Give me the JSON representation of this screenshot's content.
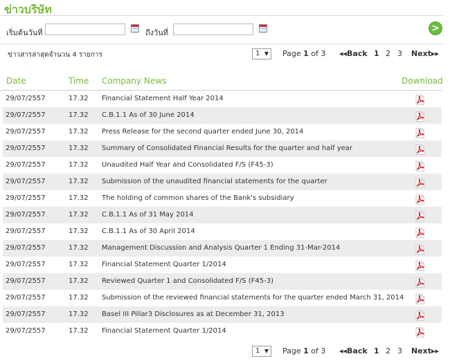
{
  "page_title": "ข่าวบริษัท",
  "search": {
    "from_label": "เริ่มต้นวันที่",
    "from_value": "",
    "to_label": "ถึงวันที่",
    "to_value": "",
    "go_label": ">"
  },
  "pager": {
    "info": "ข่าวสารล่าสุดจำนวน 4 รายการ",
    "select_value": "1",
    "select_arrow": "▼",
    "page_word": "Page",
    "current_page": "1",
    "of_word": "of",
    "total_pages": "3",
    "back_label": "◂◂Back",
    "pages": [
      "1",
      "2",
      "3"
    ],
    "next_label": "Next▸▸"
  },
  "table": {
    "headers": {
      "date": "Date",
      "time": "Time",
      "news": "Company News",
      "download": "Download"
    },
    "rows": [
      {
        "date": "29/07/2557",
        "time": "17.32",
        "news": "Financial Statement Half Year 2014"
      },
      {
        "date": "29/07/2557",
        "time": "17.32",
        "news": "C.B.1.1 As of 30 June 2014"
      },
      {
        "date": "29/07/2557",
        "time": "17.32",
        "news": "Press Release for the second quarter ended June 30, 2014"
      },
      {
        "date": "29/07/2557",
        "time": "17.32",
        "news": "Summary of Consolidated Financial Results for the quarter and half year"
      },
      {
        "date": "29/07/2557",
        "time": "17.32",
        "news": "Unaudited Half Year and Consolidated F/S (F45-3)"
      },
      {
        "date": "29/07/2557",
        "time": "17.32",
        "news": "Submission of the unaudited financial statements for the quarter"
      },
      {
        "date": "29/07/2557",
        "time": "17.32",
        "news": "The holding of common shares of the Bank's subsidiary"
      },
      {
        "date": "29/07/2557",
        "time": "17.32",
        "news": "C.B.1.1 As of 31 May 2014"
      },
      {
        "date": "29/07/2557",
        "time": "17.32",
        "news": "C.B.1.1 As of 30 April 2014"
      },
      {
        "date": "29/07/2557",
        "time": "17.32",
        "news": "Management Discussion and Analysis Quarter 1 Ending 31-Mar-2014"
      },
      {
        "date": "29/07/2557",
        "time": "17.32",
        "news": "Financial Statement Quarter 1/2014"
      },
      {
        "date": "29/07/2557",
        "time": "17.32",
        "news": "Reviewed Quarter 1 and Consolidated F/S (F45-3)"
      },
      {
        "date": "29/07/2557",
        "time": "17.32",
        "news": "Submission of the reviewed financial statements for the quarter ended March 31, 2014"
      },
      {
        "date": "29/07/2557",
        "time": "17.32",
        "news": "Basel III Pillar3 Disclosures as at December 31, 2013"
      },
      {
        "date": "29/07/2557",
        "time": "17.32",
        "news": "Financial Statement Quarter 1/2014"
      }
    ]
  },
  "colors": {
    "accent": "#7ab83a",
    "row_alt": "#ececec",
    "pdf_red": "#d11f1f"
  },
  "icons": {
    "calendar": "calendar-icon",
    "pdf": "pdf-icon",
    "go": "arrow-right-icon"
  }
}
